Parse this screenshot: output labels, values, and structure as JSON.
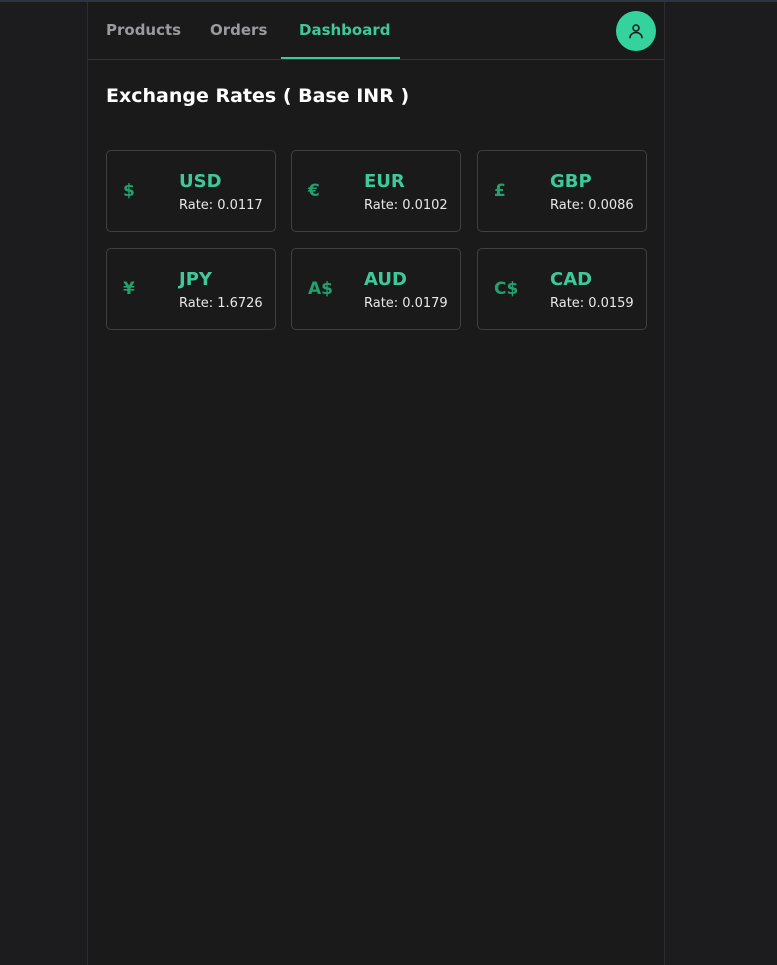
{
  "nav": {
    "tabs": [
      {
        "label": "Products"
      },
      {
        "label": "Orders"
      },
      {
        "label": "Dashboard",
        "active": true
      }
    ],
    "user_icon": "user-icon"
  },
  "page": {
    "title": "Exchange Rates ( Base INR )"
  },
  "rate_label": "Rate:",
  "currencies": [
    {
      "symbol": "$",
      "code": "USD",
      "rate": "0.0117"
    },
    {
      "symbol": "€",
      "code": "EUR",
      "rate": "0.0102"
    },
    {
      "symbol": "£",
      "code": "GBP",
      "rate": "0.0086"
    },
    {
      "symbol": "¥",
      "code": "JPY",
      "rate": "1.6726"
    },
    {
      "symbol": "A$",
      "code": "AUD",
      "rate": "0.0179"
    },
    {
      "symbol": "C$",
      "code": "CAD",
      "rate": "0.0159"
    }
  ],
  "colors": {
    "accent": "#3ec99a",
    "symbol": "#22a06f",
    "background": "#1a1a1b"
  }
}
